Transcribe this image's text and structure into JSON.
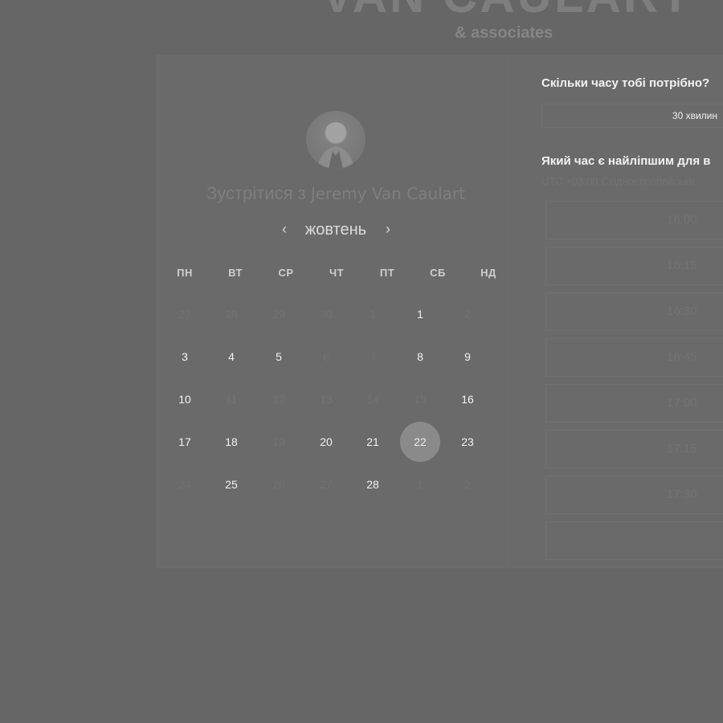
{
  "brand": {
    "name": "VAN CAULART",
    "subtitle": "& associates"
  },
  "meeting": {
    "title_prefix": "Зустрітися з",
    "host": "Jeremy Van Caulart"
  },
  "calendar": {
    "month": "жовтень",
    "prev_icon": "chevron-left-icon",
    "next_icon": "chevron-right-icon",
    "weekdays": [
      "ПН",
      "ВТ",
      "СР",
      "ЧТ",
      "ПТ",
      "СБ",
      "НД"
    ],
    "weeks": [
      [
        {
          "d": "27",
          "s": "muted"
        },
        {
          "d": "28",
          "s": "muted"
        },
        {
          "d": "29",
          "s": "muted"
        },
        {
          "d": "30",
          "s": "muted"
        },
        {
          "d": "1",
          "s": "muted"
        },
        {
          "d": "1",
          "s": "available"
        },
        {
          "d": "2",
          "s": "muted"
        }
      ],
      [
        {
          "d": "3",
          "s": "available"
        },
        {
          "d": "4",
          "s": "available"
        },
        {
          "d": "5",
          "s": "available"
        },
        {
          "d": "6",
          "s": "muted"
        },
        {
          "d": "7",
          "s": "muted"
        },
        {
          "d": "8",
          "s": "available"
        },
        {
          "d": "9",
          "s": "available"
        }
      ],
      [
        {
          "d": "10",
          "s": "available"
        },
        {
          "d": "11",
          "s": "muted"
        },
        {
          "d": "12",
          "s": "muted"
        },
        {
          "d": "13",
          "s": "muted"
        },
        {
          "d": "14",
          "s": "muted"
        },
        {
          "d": "15",
          "s": "muted"
        },
        {
          "d": "16",
          "s": "available"
        }
      ],
      [
        {
          "d": "17",
          "s": "available"
        },
        {
          "d": "18",
          "s": "available"
        },
        {
          "d": "19",
          "s": "muted"
        },
        {
          "d": "20",
          "s": "available"
        },
        {
          "d": "21",
          "s": "available"
        },
        {
          "d": "22",
          "s": "selected"
        },
        {
          "d": "23",
          "s": "available"
        }
      ],
      [
        {
          "d": "24",
          "s": "muted"
        },
        {
          "d": "25",
          "s": "available"
        },
        {
          "d": "26",
          "s": "muted"
        },
        {
          "d": "27",
          "s": "muted"
        },
        {
          "d": "28",
          "s": "available"
        },
        {
          "d": "1",
          "s": "muted"
        },
        {
          "d": "2",
          "s": "muted"
        }
      ]
    ]
  },
  "booking": {
    "duration_question": "Скільки часу тобі потрібно?",
    "duration_value": "30 хвилин",
    "time_question": "Який час є найліпшим для в",
    "timezone": "UTC +03:00 Східноєвропейськи",
    "slots": [
      "16:00",
      "16:15",
      "16:30",
      "16:45",
      "17:00",
      "17:15",
      "17:30"
    ]
  }
}
